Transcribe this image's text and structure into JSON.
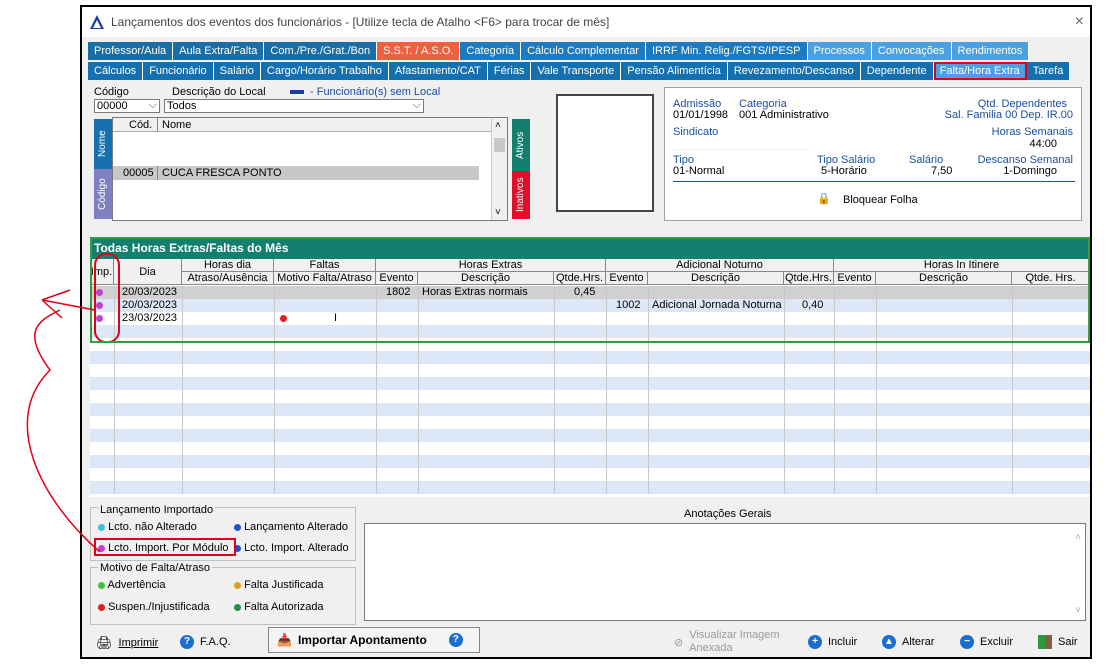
{
  "window": {
    "title": "Lançamentos dos eventos dos funcionários - [Utilize tecla de Atalho <F6> para trocar de mês]",
    "close": "×"
  },
  "tabs_row1": [
    {
      "label": "Professor/Aula",
      "cls": "t1"
    },
    {
      "label": "Aula Extra/Falta",
      "cls": "t1"
    },
    {
      "label": "Com./Pre./Grat./Bon",
      "cls": "t1"
    },
    {
      "label": "S.S.T. / A.S.O.",
      "cls": "t-orange"
    },
    {
      "label": "Categoria",
      "cls": "t3"
    },
    {
      "label": "Cálculo Complementar",
      "cls": "t3"
    },
    {
      "label": "IRRF Min. Relig./FGTS/IPESP",
      "cls": "t3"
    },
    {
      "label": "Processos",
      "cls": "t-light"
    },
    {
      "label": "Convocações",
      "cls": "t-light"
    },
    {
      "label": "Rendimentos",
      "cls": "t-light"
    }
  ],
  "tabs_row2": [
    "Cálculos",
    "Funcionário",
    "Salário",
    "Cargo/Horário Trabalho",
    "Afastamento/CAT",
    "Férias",
    "Vale Transporte",
    "Pensão Alimentícia",
    "Revezamento/Descanso",
    "Dependente",
    "Falta/Hora Extra",
    "Tarefa"
  ],
  "local": {
    "codigo_label": "Código",
    "descricao_label": "Descrição do Local",
    "codigo_value": "00000",
    "descricao_value": "Todos",
    "legend": "- Funcionário(s) sem Local"
  },
  "list": {
    "col_cod": "Cód.",
    "col_nome": "Nome",
    "row_cod": "00005",
    "row_nome": "CUCA FRESCA PONTO",
    "tab_nome": "Nome",
    "tab_codigo": "Código",
    "tab_ativos": "Ativos",
    "tab_inativos": "Inativos"
  },
  "info": {
    "admissao_label": "Admissão",
    "admissao": "01/01/1998",
    "categoria_label": "Categoria",
    "categoria": "001  Administrativo",
    "dep_label": "Qtd. Dependentes",
    "dep_value": "Sal. Familia 00   Dep. IR.00",
    "sindicato_label": "Sindicato",
    "horas_sem_label": "Horas Semanais",
    "horas_sem": "44:00",
    "tipo_label": "Tipo",
    "tipo": "01-Normal",
    "tipo_sal_label": "Tipo Salário",
    "tipo_sal": "5-Horário",
    "salario_label": "Salário",
    "salario": "7,50",
    "descanso_label": "Descanso Semanal",
    "descanso": "1-Domingo",
    "bloquear": "Bloquear Folha"
  },
  "grid": {
    "title": "Todas Horas Extras/Faltas  do Mês",
    "groups": [
      "Horas dia",
      "Faltas",
      "Horas Extras",
      "Adicional Noturno",
      "Horas In Itinere"
    ],
    "cols": [
      "Imp.",
      "Dia",
      "Atraso/Ausência",
      "Motivo Falta/Atraso",
      "Evento",
      "Descrição",
      "Qtde.Hrs.",
      "Evento",
      "Descrição",
      "Qtde.Hrs.",
      "Evento",
      "Descrição",
      "Qtde. Hrs."
    ],
    "rows": [
      {
        "dia": "20/03/2023",
        "he_evento": "1802",
        "he_desc": "Horas Extras normais",
        "he_qtd": "0,45",
        "an_evento": "",
        "an_desc": "",
        "an_qtd": "",
        "falta": ""
      },
      {
        "dia": "20/03/2023",
        "he_evento": "",
        "he_desc": "",
        "he_qtd": "",
        "an_evento": "1002",
        "an_desc": "Adicional Jornada Noturna",
        "an_qtd": "0,40",
        "falta": ""
      },
      {
        "dia": "23/03/2023",
        "he_evento": "",
        "he_desc": "",
        "he_qtd": "",
        "an_evento": "",
        "an_desc": "",
        "an_qtd": "",
        "falta": "I"
      }
    ]
  },
  "legend": {
    "lancamento_title": "Lançamento Importado",
    "nao_alterado": "Lcto. não Alterado",
    "alterado": "Lançamento Alterado",
    "import_modulo": "Lcto. Import. Por Módulo",
    "import_alterado": "Lcto. Import. Alterado",
    "motivo_title": "Motivo de Falta/Atraso",
    "advertencia": "Advertência",
    "justificada": "Falta Justificada",
    "suspensao": "Suspen./Injustificada",
    "autorizada": "Falta Autorizada",
    "anotacoes": "Anotações Gerais"
  },
  "buttons": {
    "imprimir": "Imprimir",
    "faq": "F.A.Q.",
    "importar": "Importar Apontamento",
    "visualizar": "Visualizar Imagem\nAnexada",
    "incluir": "Incluir",
    "alterar": "Alterar",
    "excluir": "Excluir",
    "sair": "Sair"
  },
  "colors": {
    "import_modulo": "#c040d0",
    "nao_alterado": "#40c0e0",
    "alterado": "#2050d0",
    "advertencia": "#40c040",
    "justificada": "#e0a020",
    "suspensao": "#e02020",
    "autorizada": "#209040"
  }
}
